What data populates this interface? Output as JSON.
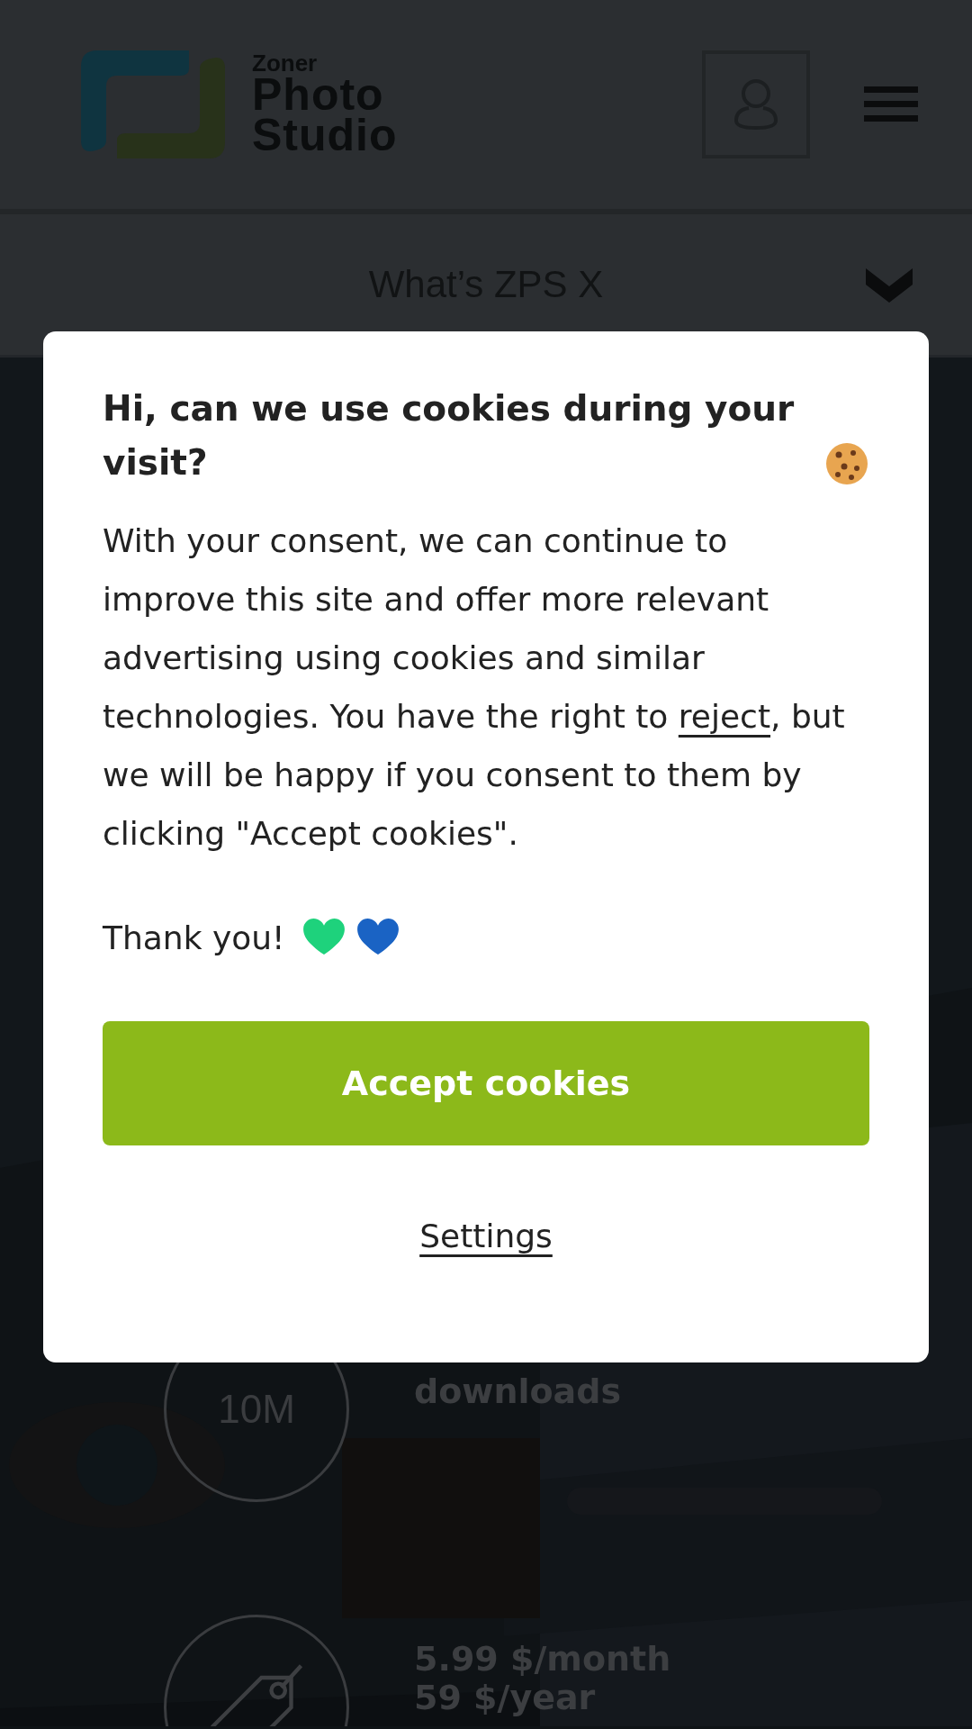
{
  "header": {
    "logo": {
      "small": "Zoner",
      "line1": "Photo",
      "line2": "Studio"
    }
  },
  "subnav": {
    "label": "What’s ZPS X"
  },
  "stats": [
    {
      "kind": "number",
      "value": "10M",
      "lines": [
        "downloads"
      ]
    },
    {
      "kind": "tag",
      "lines": [
        "5.99 $/month",
        "59 $/year"
      ]
    }
  ],
  "cookie_dialog": {
    "title": "Hi, can we use cookies during your visit?",
    "body_before": "With your consent, we can continue to improve this site and offer more relevant advertising using cookies and similar technologies. You have the right to ",
    "link": "reject",
    "body_after": ", but we will be happy if you consent to them by clicking \"Accept cookies\".",
    "thanks": "Thank you!",
    "hearts": [
      {
        "color": "#1ed27c"
      },
      {
        "color": "#1a63c4"
      }
    ],
    "accept_button": "Accept cookies",
    "settings_link": "Settings"
  }
}
